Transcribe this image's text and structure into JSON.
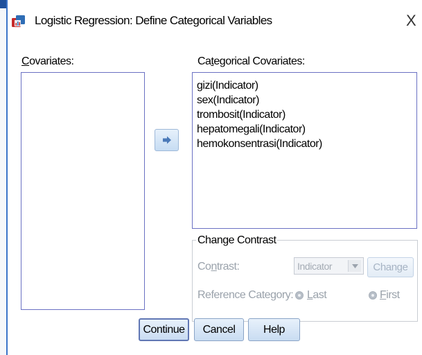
{
  "window": {
    "title": "Logistic Regression: Define Categorical Variables",
    "close_symbol": "X",
    "icon": "spss-dialog-icon"
  },
  "covariates": {
    "label_key": "C",
    "label_rest": "ovariates:",
    "items": []
  },
  "move_button": {
    "icon": "arrow-right-icon"
  },
  "categorical_covariates": {
    "label_pre": "Ca",
    "label_key": "t",
    "label_post": "egorical Covariates:",
    "items": [
      "gizi(Indicator)",
      "sex(Indicator)",
      "trombosit(Indicator)",
      "hepatomegali(Indicator)",
      "hemokonsentrasi(Indicator)"
    ]
  },
  "change_contrast": {
    "title": "Change Contrast",
    "contrast_label_pre": "Co",
    "contrast_label_key": "n",
    "contrast_label_post": "trast:",
    "contrast_value": "Indicator",
    "change_button": "Change",
    "reference_label": "Reference Category:",
    "last_key": "L",
    "last_rest": "ast",
    "first_key": "F",
    "first_rest": "irst",
    "selected": "Last"
  },
  "buttons": {
    "continue": "Continue",
    "cancel": "Cancel",
    "help": "Help"
  },
  "colors": {
    "list_border": "#6a71c3",
    "accent": "#3b74c9",
    "button_gradient_top": "#e8f1fb",
    "button_gradient_bottom": "#c9dcf2",
    "disabled_text": "#9aa2ab"
  }
}
